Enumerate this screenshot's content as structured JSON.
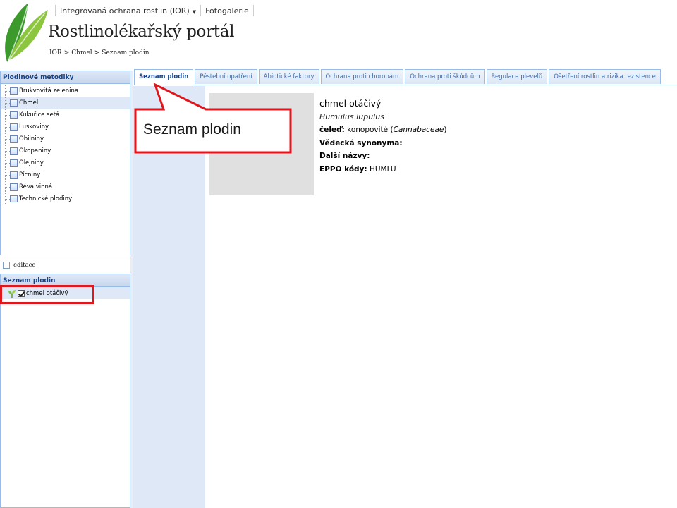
{
  "header": {
    "nav": [
      {
        "label": "Integrovaná ochrana rostlin (IOR)",
        "has_dropdown": true
      },
      {
        "label": "Fotogalerie",
        "has_dropdown": false
      }
    ],
    "site_title": "Rostlinolékařský portál",
    "breadcrumb": [
      "IOR",
      "Chmel",
      "Seznam plodin"
    ],
    "breadcrumb_separator": ">"
  },
  "sidebar": {
    "methods_panel_title": "Plodinové metodiky",
    "methods": [
      {
        "label": "Brukvovitá zelenina",
        "selected": false
      },
      {
        "label": "Chmel",
        "selected": true
      },
      {
        "label": "Kukuřice setá",
        "selected": false
      },
      {
        "label": "Luskoviny",
        "selected": false
      },
      {
        "label": "Obilniny",
        "selected": false
      },
      {
        "label": "Okopaniny",
        "selected": false
      },
      {
        "label": "Olejniny",
        "selected": false
      },
      {
        "label": "Pícniny",
        "selected": false
      },
      {
        "label": "Réva vinná",
        "selected": false
      },
      {
        "label": "Technické plodiny",
        "selected": false
      }
    ],
    "edit_label": "editace",
    "crops_panel_title": "Seznam plodin",
    "crop_item": {
      "label": "chmel otáčivý",
      "checked": true
    }
  },
  "tabs": [
    {
      "label": "Seznam plodin",
      "active": true
    },
    {
      "label": "Pěstební opatření",
      "active": false
    },
    {
      "label": "Abiotické faktory",
      "active": false
    },
    {
      "label": "Ochrana proti chorobám",
      "active": false
    },
    {
      "label": "Ochrana proti škůdcům",
      "active": false
    },
    {
      "label": "Regulace plevelů",
      "active": false
    },
    {
      "label": "Ošetření rostlin a rizika rezistence",
      "active": false
    }
  ],
  "crop_detail": {
    "common_name": "chmel otáčivý",
    "latin_name": "Humulus lupulus",
    "family_label": "čeleď:",
    "family_value": "konopovité (",
    "family_latin": "Cannabaceae",
    "family_close": ")",
    "synonyms_label": "Vědecká synonyma:",
    "other_names_label": "Další názvy:",
    "eppo_label": "EPPO kódy:",
    "eppo_value": "HUMLU"
  },
  "annotation": {
    "callout_text": "Seznam plodin",
    "color": "#e0161d"
  },
  "colors": {
    "panel_header": "#15428b",
    "panel_border": "#99bbe8",
    "selected_row": "#dfe8f6",
    "photo_placeholder": "#e0e0e0"
  }
}
